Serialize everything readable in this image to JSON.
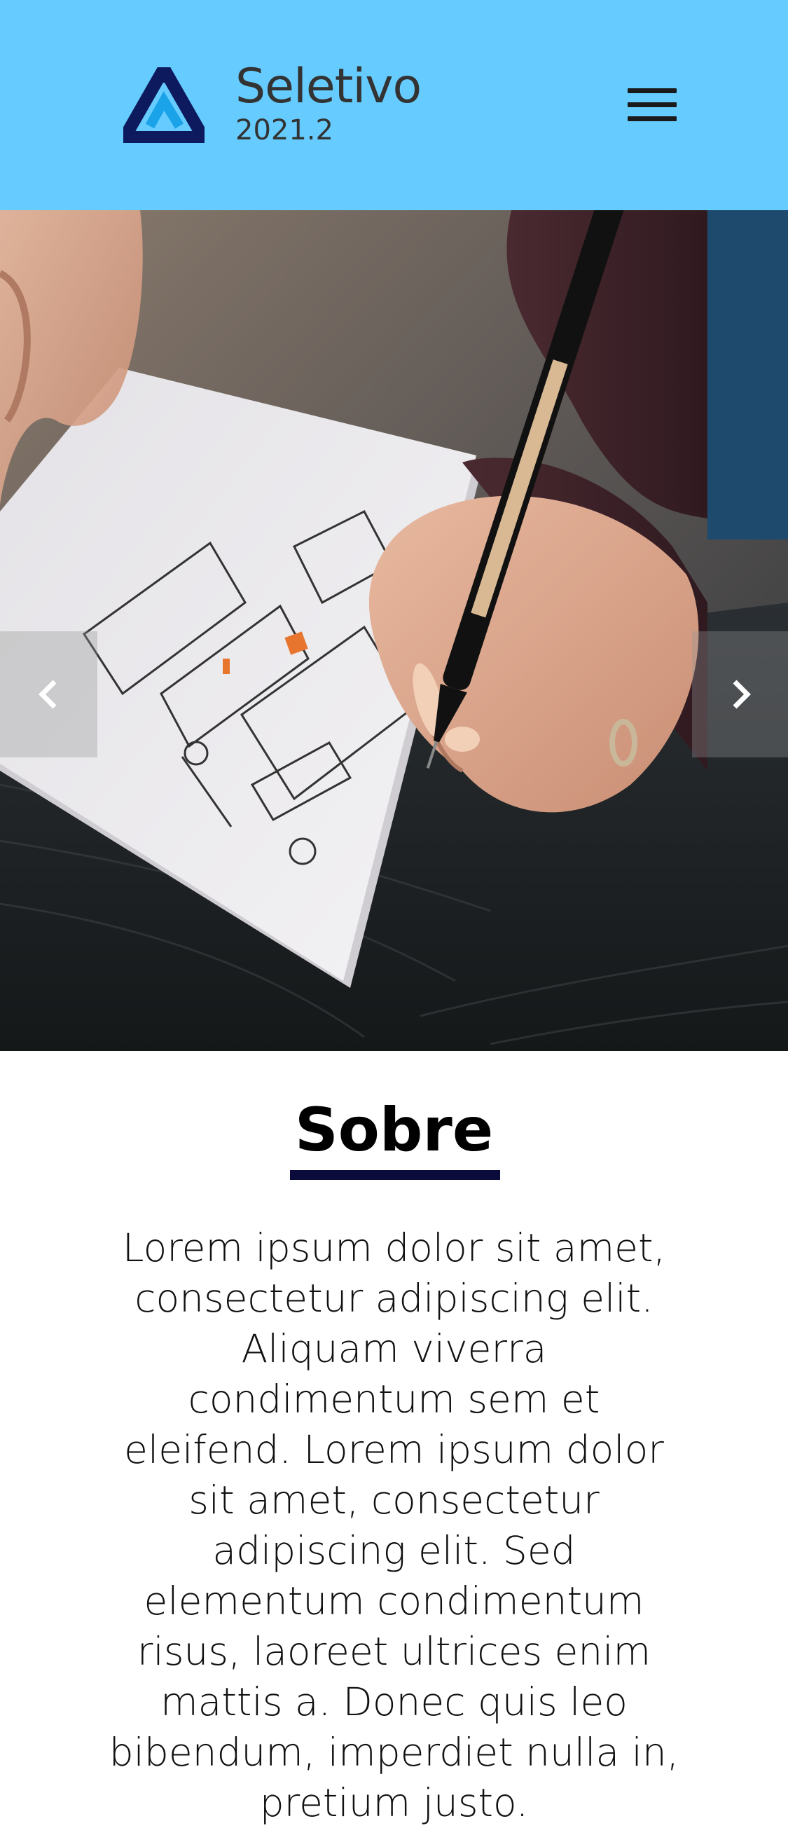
{
  "header": {
    "title": "Seletivo",
    "subtitle": "2021.2",
    "logo_icon": "triangle-logo-icon",
    "menu_icon": "hamburger-menu-icon",
    "background_color": "#66CCFF",
    "logo_colors": [
      "#0d1b5e",
      "#1aa3e8"
    ]
  },
  "hero": {
    "image_description_icon": "hero-photo",
    "prev_icon": "chevron-left-icon",
    "next_icon": "chevron-right-icon"
  },
  "about": {
    "title": "Sobre",
    "underline_color": "#0b0b3b",
    "body": "Lorem ipsum dolor sit amet, consectetur adipiscing elit. Aliquam viverra condimentum sem et eleifend. Lorem ipsum dolor sit amet, consectetur adipiscing elit. Sed elementum condimentum risus, laoreet ultrices enim mattis a. Donec quis leo bibendum, imperdiet nulla in, pretium justo."
  }
}
